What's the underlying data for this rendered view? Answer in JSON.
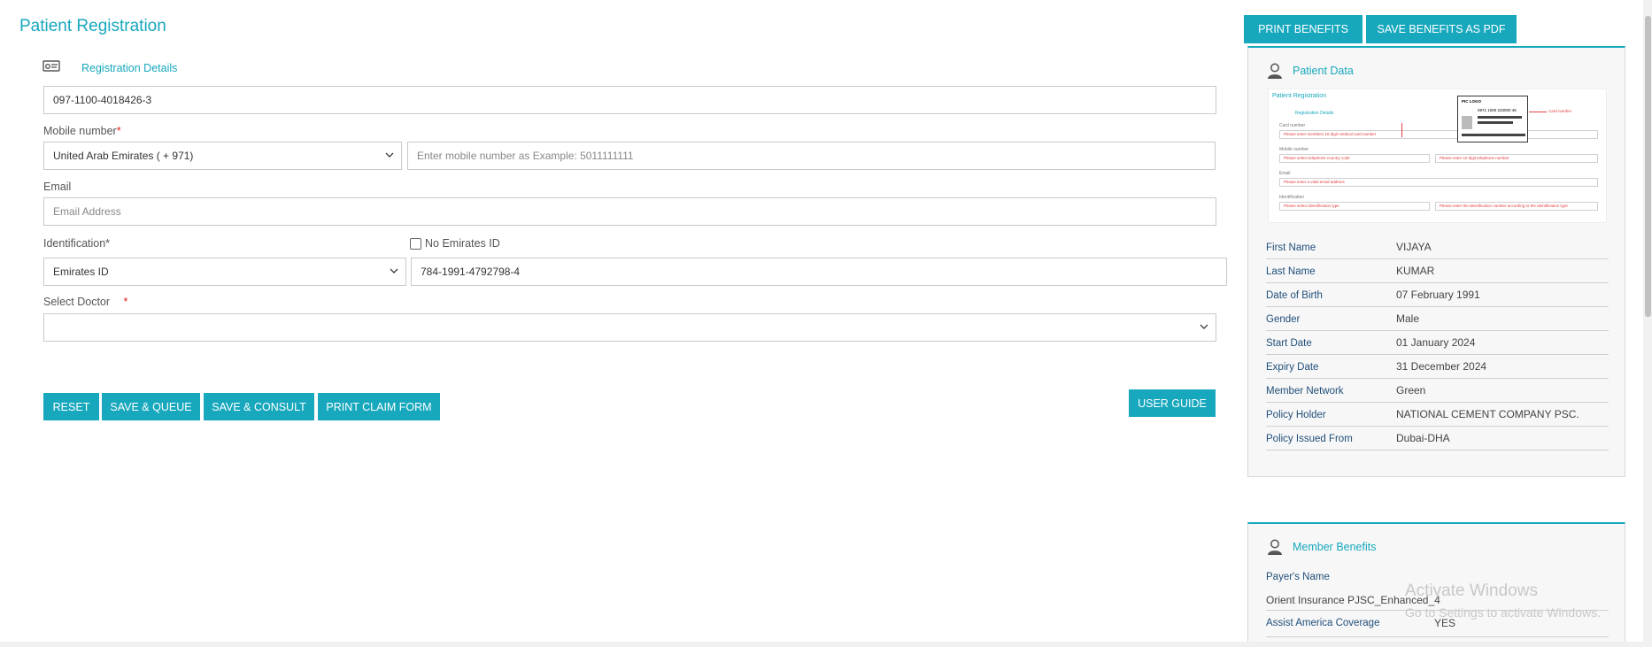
{
  "page_title": "Patient Registration",
  "registration": {
    "section_label": "Registration Details",
    "card_number": "097-1100-4018426-3",
    "mobile_label": "Mobile number",
    "required_mark": "*",
    "country_code": "United Arab Emirates ( + 971)",
    "mobile_placeholder": "Enter mobile number as Example: 5011111111",
    "email_label": "Email",
    "email_placeholder": "Email Address",
    "identification_label": "Identification*",
    "no_emirates_id_label": "No Emirates ID",
    "id_type": "Emirates ID",
    "id_number": "784-1991-4792798-4",
    "doctor_label": "Select Doctor",
    "doctor_value": ""
  },
  "actions": {
    "reset": "RESET",
    "save_queue": "SAVE & QUEUE",
    "save_consult": "SAVE & CONSULT",
    "print_claim": "PRINT CLAIM FORM",
    "user_guide": "USER GUIDE",
    "print_benefits": "PRINT BENEFITS",
    "save_benefits_pdf": "SAVE BENEFITS AS PDF"
  },
  "patient_data": {
    "title": "Patient Data",
    "sample_form": {
      "title": "Patient Registration",
      "section": "Registration Details",
      "card_label": "Card number",
      "card_hint": "Please enter members 16 digit medical card number",
      "mobile_label": "Mobile number",
      "mobile_country_hint": "Please select telephone country code",
      "mobile_number_hint": "Please enter 10 digit telephone number",
      "email_label": "Email",
      "email_hint": "Please enter a valid email address",
      "id_label": "Identification",
      "id_type_hint": "Please select identification type",
      "id_number_hint": "Please enter the identification number according to the identification type",
      "card_logo": "PIC LOGO",
      "card_number_text": "0971 1000 233000 45",
      "card_annotation": "Card number"
    },
    "fields": [
      {
        "label": "First Name",
        "value": "VIJAYA"
      },
      {
        "label": "Last Name",
        "value": "KUMAR"
      },
      {
        "label": "Date of Birth",
        "value": "07 February 1991"
      },
      {
        "label": "Gender",
        "value": "Male"
      },
      {
        "label": "Start Date",
        "value": "01 January 2024"
      },
      {
        "label": "Expiry Date",
        "value": "31 December 2024"
      },
      {
        "label": "Member Network",
        "value": "Green"
      },
      {
        "label": "Policy Holder",
        "value": "NATIONAL CEMENT COMPANY PSC."
      },
      {
        "label": "Policy Issued From",
        "value": "Dubai-DHA"
      }
    ]
  },
  "member_benefits": {
    "title": "Member Benefits",
    "payer_label": "Payer's Name",
    "payer_value": "Orient Insurance PJSC_Enhanced_4",
    "assist_label": "Assist America Coverage",
    "assist_value": "YES"
  },
  "watermark": {
    "line1": "Activate Windows",
    "line2": "Go to Settings to activate Windows."
  },
  "colors": {
    "accent": "#17a8bd",
    "required": "#e02020",
    "field_label": "#1f4e79"
  }
}
